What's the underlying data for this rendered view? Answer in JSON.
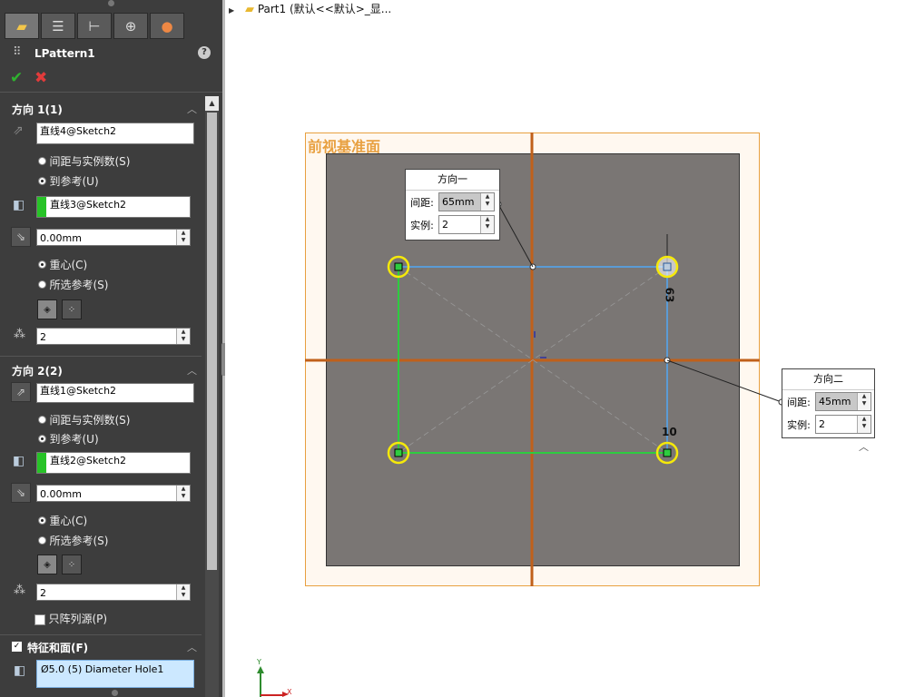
{
  "tree": {
    "text": "Part1  (默认<<默认>_显..."
  },
  "feature": {
    "title": "LPattern1"
  },
  "dir1": {
    "header": "方向 1(1)",
    "edge": "直线4@Sketch2",
    "opt_spacing": "间距与实例数(S)",
    "opt_reference": "到参考(U)",
    "ref": "直线3@Sketch2",
    "offset": "0.00mm",
    "opt_centroid": "重心(C)",
    "opt_selected": "所选参考(S)",
    "instances": "2"
  },
  "dir2": {
    "header": "方向 2(2)",
    "edge": "直线1@Sketch2",
    "opt_spacing": "间距与实例数(S)",
    "opt_reference": "到参考(U)",
    "ref": "直线2@Sketch2",
    "offset": "0.00mm",
    "opt_centroid": "重心(C)",
    "opt_selected": "所选参考(S)",
    "instances": "2",
    "seed_only": "只阵列源(P)"
  },
  "features": {
    "header": "特征和面(F)",
    "item": "Ø5.0 (5) Diameter Hole1"
  },
  "plane": {
    "label": "前视基准面"
  },
  "callout1": {
    "title": "方向一",
    "spacing_label": "间距:",
    "spacing": "65mm",
    "instances_label": "实例:",
    "instances": "2"
  },
  "callout2": {
    "title": "方向二",
    "spacing_label": "间距:",
    "spacing": "45mm",
    "instances_label": "实例:",
    "instances": "2"
  },
  "dims": {
    "top": "63",
    "bottom": "10"
  },
  "triad": {
    "y": "Y",
    "x": "X"
  },
  "colors": {
    "panel": "#3d3d3d",
    "sketch_blue": "#5b9bd5",
    "sketch_green": "#2ecc40",
    "plane_orange": "#e8a040",
    "axis_brown": "#c0601a",
    "highlight_yellow": "#f5e90a"
  }
}
